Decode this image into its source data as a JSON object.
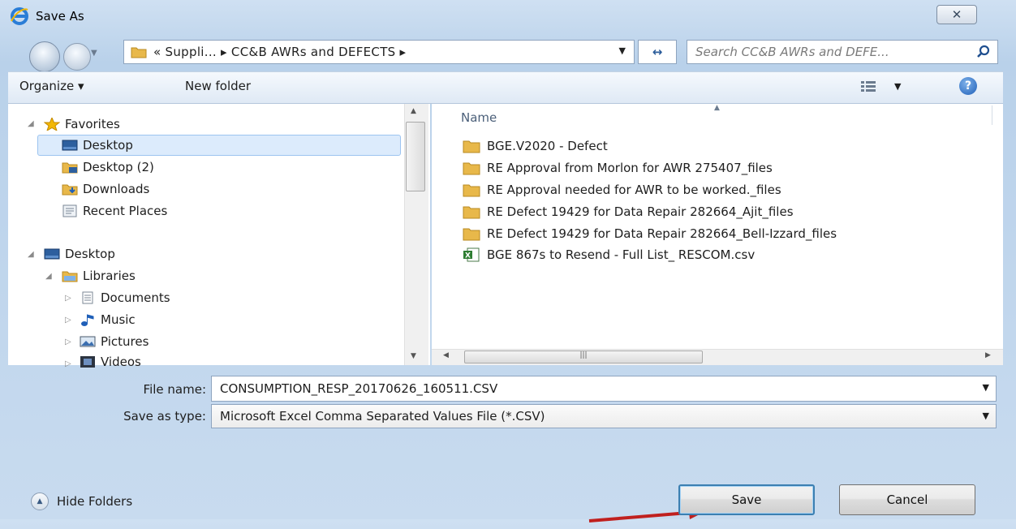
{
  "window": {
    "title": "Save As",
    "close_glyph": "✕"
  },
  "address": {
    "path": "« Suppli... ▸ CC&B AWRs and DEFECTS ▸",
    "refresh_glyph": "↔",
    "search_placeholder": "Search CC&B AWRs and DEFE..."
  },
  "toolbar": {
    "organize_label": "Organize ▾",
    "new_folder_label": "New folder",
    "help_glyph": "?"
  },
  "nav": {
    "favorites_label": "Favorites",
    "favorites": [
      {
        "label": "Desktop",
        "icon": "desktop-icon"
      },
      {
        "label": "Desktop (2)",
        "icon": "folder-icon"
      },
      {
        "label": "Downloads",
        "icon": "downloads-icon"
      },
      {
        "label": "Recent Places",
        "icon": "recent-places-icon"
      }
    ],
    "desktop_label": "Desktop",
    "libraries_label": "Libraries",
    "libraries": [
      {
        "label": "Documents",
        "icon": "documents-icon"
      },
      {
        "label": "Music",
        "icon": "music-icon"
      },
      {
        "label": "Pictures",
        "icon": "pictures-icon"
      },
      {
        "label": "Videos",
        "icon": "videos-icon"
      }
    ]
  },
  "files": {
    "column_name": "Name",
    "items": [
      {
        "label": "BGE.V2020 - Defect",
        "icon": "folder-icon"
      },
      {
        "label": "RE Approval from Morlon for AWR 275407_files",
        "icon": "folder-icon"
      },
      {
        "label": "RE Approval needed for AWR to be worked._files",
        "icon": "folder-icon"
      },
      {
        "label": "RE Defect 19429 for Data Repair 282664_Ajit_files",
        "icon": "folder-icon"
      },
      {
        "label": "RE Defect 19429 for Data Repair 282664_Bell-Izzard_files",
        "icon": "folder-icon"
      },
      {
        "label": "BGE 867s to Resend - Full List_ RESCOM.csv",
        "icon": "excel-csv-icon"
      }
    ]
  },
  "form": {
    "file_name_label": "File name:",
    "file_name_value": "CONSUMPTION_RESP_20170626_160511.CSV",
    "type_label": "Save as type:",
    "type_value": "Microsoft Excel Comma Separated Values File (*.CSV)"
  },
  "footer": {
    "hide_folders_label": "Hide Folders",
    "save_label": "Save",
    "cancel_label": "Cancel"
  },
  "colors": {
    "accent": "#3c7fb1",
    "folder": "#e8b84a",
    "arrow": "#c0201e"
  }
}
